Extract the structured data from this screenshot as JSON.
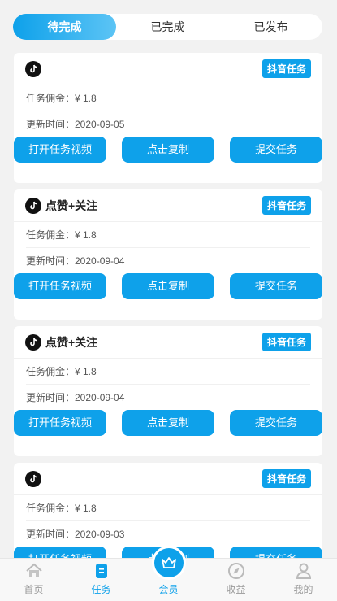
{
  "tabs": [
    {
      "label": "待完成",
      "active": true
    },
    {
      "label": "已完成",
      "active": false
    },
    {
      "label": "已发布",
      "active": false
    }
  ],
  "tasks": [
    {
      "title": "",
      "tag": "抖音任务",
      "commission": "任务佣金：¥ 1.8",
      "updated": "更新时间：2020-09-05",
      "buttons": [
        "打开任务视频",
        "点击复制",
        "提交任务"
      ]
    },
    {
      "title": "点赞+关注",
      "tag": "抖音任务",
      "commission": "任务佣金：¥ 1.8",
      "updated": "更新时间：2020-09-04",
      "buttons": [
        "打开任务视频",
        "点击复制",
        "提交任务"
      ]
    },
    {
      "title": "点赞+关注",
      "tag": "抖音任务",
      "commission": "任务佣金：¥ 1.8",
      "updated": "更新时间：2020-09-04",
      "buttons": [
        "打开任务视频",
        "点击复制",
        "提交任务"
      ]
    },
    {
      "title": "",
      "tag": "抖音任务",
      "commission": "任务佣金：¥ 1.8",
      "updated": "更新时间：2020-09-03",
      "buttons": [
        "打开任务视频",
        "点击复制",
        "提交任务"
      ]
    }
  ],
  "nav": [
    {
      "label": "首页",
      "icon": "home-icon"
    },
    {
      "label": "任务",
      "icon": "task-icon",
      "active": true
    },
    {
      "label": "会员",
      "icon": "crown-icon"
    },
    {
      "label": "收益",
      "icon": "compass-icon"
    },
    {
      "label": "我的",
      "icon": "user-icon"
    }
  ],
  "colors": {
    "accent": "#0ea1ea"
  }
}
